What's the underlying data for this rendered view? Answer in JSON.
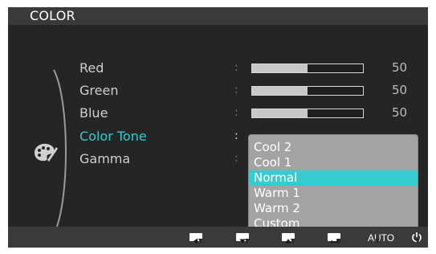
{
  "title": "COLOR",
  "menu_items": [
    {
      "label": "Red",
      "value": "50",
      "level": 0.5
    },
    {
      "label": "Green",
      "value": "50",
      "level": 0.5
    },
    {
      "label": "Blue",
      "value": "50",
      "level": 0.5
    },
    {
      "label": "Color Tone"
    },
    {
      "label": "Gamma"
    }
  ],
  "colon": ":",
  "dropdown": {
    "options": [
      "Cool 2",
      "Cool 1",
      "Normal",
      "Warm 1",
      "Warm 2",
      "Custom"
    ],
    "selected": "Normal"
  },
  "bottom_bar": {
    "auto_label": "AUTO",
    "buttons": [
      "left-arrow-icon",
      "down-arrow-icon",
      "up-arrow-icon",
      "enter-icon",
      "auto",
      "power-icon"
    ]
  },
  "colors": {
    "accent": "#35cbd1",
    "background": "#262626",
    "bar": "#3a3a3a"
  }
}
